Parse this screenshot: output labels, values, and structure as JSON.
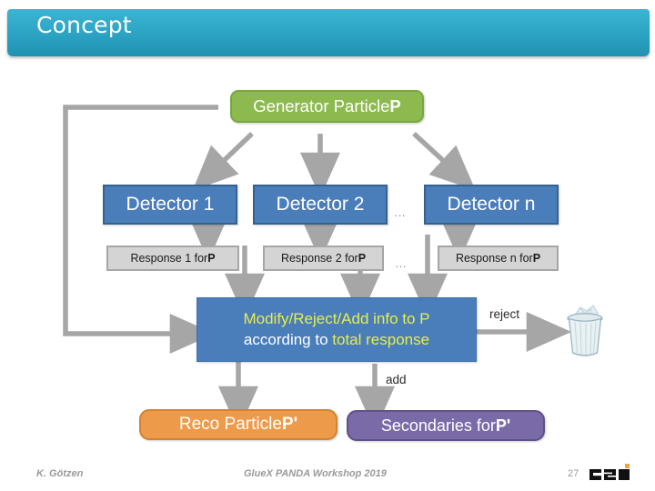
{
  "slide": {
    "title": "Concept"
  },
  "diagram": {
    "generator": {
      "text_plain": "Generator Particle ",
      "symbol": "P"
    },
    "detectors": [
      {
        "label": "Detector 1"
      },
      {
        "label": "Detector 2"
      },
      {
        "label": "Detector n"
      }
    ],
    "detector_ellipsis": "…",
    "responses": [
      {
        "text_plain": "Response 1 for ",
        "symbol": "P"
      },
      {
        "text_plain": "Response 2 for ",
        "symbol": "P"
      },
      {
        "text_plain": "Response n for ",
        "symbol": "P"
      }
    ],
    "response_ellipsis": "…",
    "modify": {
      "line1": "Modify/Reject/Add info to P",
      "line2_plain": "according to ",
      "line2_highlight": "total response"
    },
    "reco": {
      "text_plain": "Reco Particle ",
      "symbol": "P'"
    },
    "secondaries": {
      "text_plain": "Secondaries for ",
      "symbol": "P'"
    },
    "edge_labels": {
      "reject": "reject",
      "add": "add"
    },
    "trash_icon": "trash-bin-icon",
    "colors": {
      "title_bar": "#2ea6c6",
      "generator": "#8cba4f",
      "detector": "#4a7ebb",
      "response": "#d4d4d4",
      "modify": "#4a7ebb",
      "modify_highlight": "#e8ed4a",
      "reco": "#ed9b4b",
      "secondaries": "#7b6aa8",
      "connector": "#a6a6a6"
    }
  },
  "footer": {
    "author": "K. Götzen",
    "event": "GlueX PANDA Workshop 2019",
    "page": "27",
    "logo": "gsi-logo"
  }
}
